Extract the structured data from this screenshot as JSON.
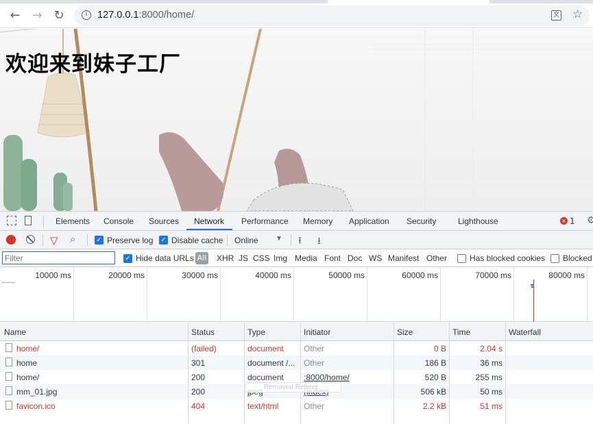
{
  "browser": {
    "url_host": "127.0.0.1",
    "url_rest": ":8000/home/"
  },
  "page": {
    "heading": "欢迎来到妹子工厂"
  },
  "devtools": {
    "tabs": [
      "Elements",
      "Console",
      "Sources",
      "Network",
      "Performance",
      "Memory",
      "Application",
      "Security",
      "Lighthouse"
    ],
    "active_tab": "Network",
    "error_count": "1",
    "controls": {
      "preserve_log": "Preserve log",
      "disable_cache": "Disable cache",
      "throttle": "Online"
    },
    "filter": {
      "placeholder": "Filter",
      "hide_data_urls": "Hide data URLs",
      "all": "All",
      "types": [
        "XHR",
        "JS",
        "CSS",
        "Img",
        "Media",
        "Font",
        "Doc",
        "WS",
        "Manifest",
        "Other"
      ],
      "has_blocked_cookies": "Has blocked cookies",
      "blocked": "Blocked"
    },
    "overview_ticks": [
      "10000 ms",
      "20000 ms",
      "30000 ms",
      "40000 ms",
      "50000 ms",
      "60000 ms",
      "70000 ms",
      "80000 ms"
    ],
    "columns": [
      "Name",
      "Status",
      "Type",
      "Initiator",
      "Size",
      "Time",
      "Waterfall"
    ],
    "rows": [
      {
        "name": "home/",
        "status": "(failed)",
        "type": "document",
        "initiator": "Other",
        "size": "0 B",
        "time": "2.04 s",
        "error": true
      },
      {
        "name": "home",
        "status": "301",
        "type": "document /...",
        "initiator": "Other",
        "size": "186 B",
        "time": "36 ms",
        "error": false
      },
      {
        "name": "home/",
        "status": "200",
        "type": "document",
        "initiator": ":8000/home/",
        "size": "520 B",
        "time": "255 ms",
        "error": false
      },
      {
        "name": "mm_01.jpg",
        "status": "200",
        "type": "jpeg",
        "initiator": "(index)",
        "size": "506 kB",
        "time": "50 ms",
        "error": false
      },
      {
        "name": "favicon.ico",
        "status": "404",
        "type": "text/html",
        "initiator": "Other",
        "size": "2.2 kB",
        "time": "51 ms",
        "error": true
      }
    ],
    "ghost_text": "Removed Referer"
  }
}
